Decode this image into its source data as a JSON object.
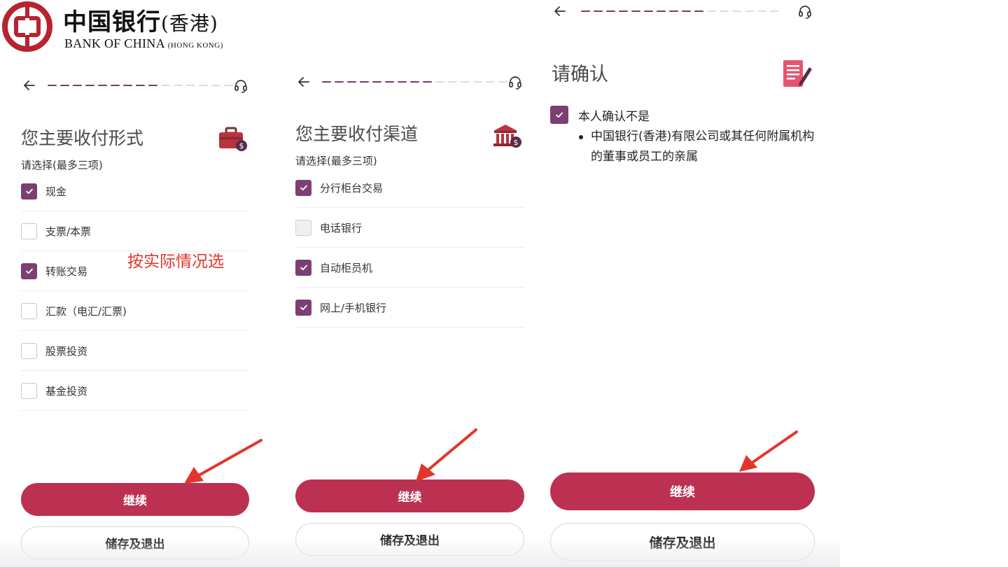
{
  "logo": {
    "cn_name": "中国银行",
    "cn_suffix": "(香港)",
    "en_name": "BANK OF CHINA",
    "en_suffix": "(HONG KONG)"
  },
  "colors": {
    "brand_red": "#bc3152",
    "check_purple": "#7b3f73",
    "annotation_red": "#e2362b",
    "progress_active": "#7a3a6a"
  },
  "icons": {
    "back": "arrow-left-icon",
    "support": "headset-icon",
    "panel1_header": "briefcase-dollar-icon",
    "panel2_header": "bank-dollar-icon",
    "panel3_header": "document-pen-icon"
  },
  "panel1": {
    "progress": {
      "filled": 9,
      "total": 15
    },
    "title": "您主要收付形式",
    "subtitle": "请选择(最多三项)",
    "options": [
      {
        "label": "现金",
        "checked": true
      },
      {
        "label": "支票/本票",
        "checked": false
      },
      {
        "label": "转账交易",
        "checked": true
      },
      {
        "label": "汇款（电汇/汇票)",
        "checked": false
      },
      {
        "label": "股票投资",
        "checked": false
      },
      {
        "label": "基金投资",
        "checked": false
      }
    ],
    "annotation": "按实际情况选",
    "continue_label": "继续",
    "save_exit_label": "储存及退出"
  },
  "panel2": {
    "progress": {
      "filled": 9,
      "total": 15
    },
    "title": "您主要收付渠道",
    "subtitle": "请选择(最多三项)",
    "options": [
      {
        "label": "分行柜台交易",
        "checked": true,
        "disabled": false
      },
      {
        "label": "电话银行",
        "checked": false,
        "disabled": true
      },
      {
        "label": "自动柜员机",
        "checked": true,
        "disabled": false
      },
      {
        "label": "网上/手机银行",
        "checked": true,
        "disabled": false
      }
    ],
    "continue_label": "继续",
    "save_exit_label": "储存及退出"
  },
  "panel3": {
    "progress": {
      "filled": 10,
      "total": 16
    },
    "title": "请确认",
    "confirm_label": "本人确认不是",
    "confirm_checked": true,
    "bullets": [
      "中国银行(香港)有限公司或其任何附属机构的董事或员工的亲属"
    ],
    "continue_label": "继续",
    "save_exit_label": "储存及退出"
  }
}
